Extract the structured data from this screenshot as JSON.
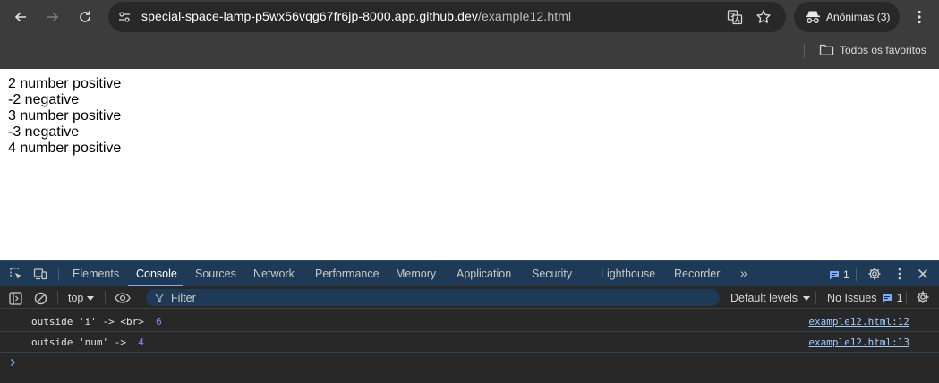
{
  "browser": {
    "url_host": "special-space-lamp-p5wx56vqg67fr6jp-8000.app.github.dev",
    "url_path": "/example12.html",
    "profile_label": "Anônimas (3)",
    "bookmarks_label": "Todos os favoritos",
    "icons": {
      "back": "back-arrow-icon",
      "forward": "forward-arrow-icon",
      "reload": "reload-icon",
      "site_info": "tune-icon",
      "translate": "translate-icon",
      "bookmark": "star-icon",
      "profile": "incognito-icon",
      "menu": "kebab-menu-icon",
      "folder": "folder-icon"
    }
  },
  "page": {
    "lines": [
      "2 number positive",
      "-2 negative",
      "3 number positive",
      "-3 negative",
      "4 number positive"
    ]
  },
  "devtools": {
    "tabs": [
      "Elements",
      "Console",
      "Sources",
      "Network",
      "Performance",
      "Memory",
      "Application",
      "Security",
      "Lighthouse",
      "Recorder"
    ],
    "active_tab": "Console",
    "more_tabs": "»",
    "issues_count": "1",
    "context": "top",
    "filter_placeholder": "Filter",
    "levels": "Default levels",
    "no_issues": "No Issues",
    "no_issues_count": "1",
    "messages": [
      {
        "text": "outside 'i' -> <br>",
        "value": "6",
        "source": "example12.html:12"
      },
      {
        "text": "outside 'num' ->",
        "value": "4",
        "source": "example12.html:13"
      }
    ],
    "colors": {
      "tab_bar": "#1e3a56",
      "accent": "#7cacf8",
      "number": "#9980ff",
      "link": "#9ecbff"
    }
  }
}
